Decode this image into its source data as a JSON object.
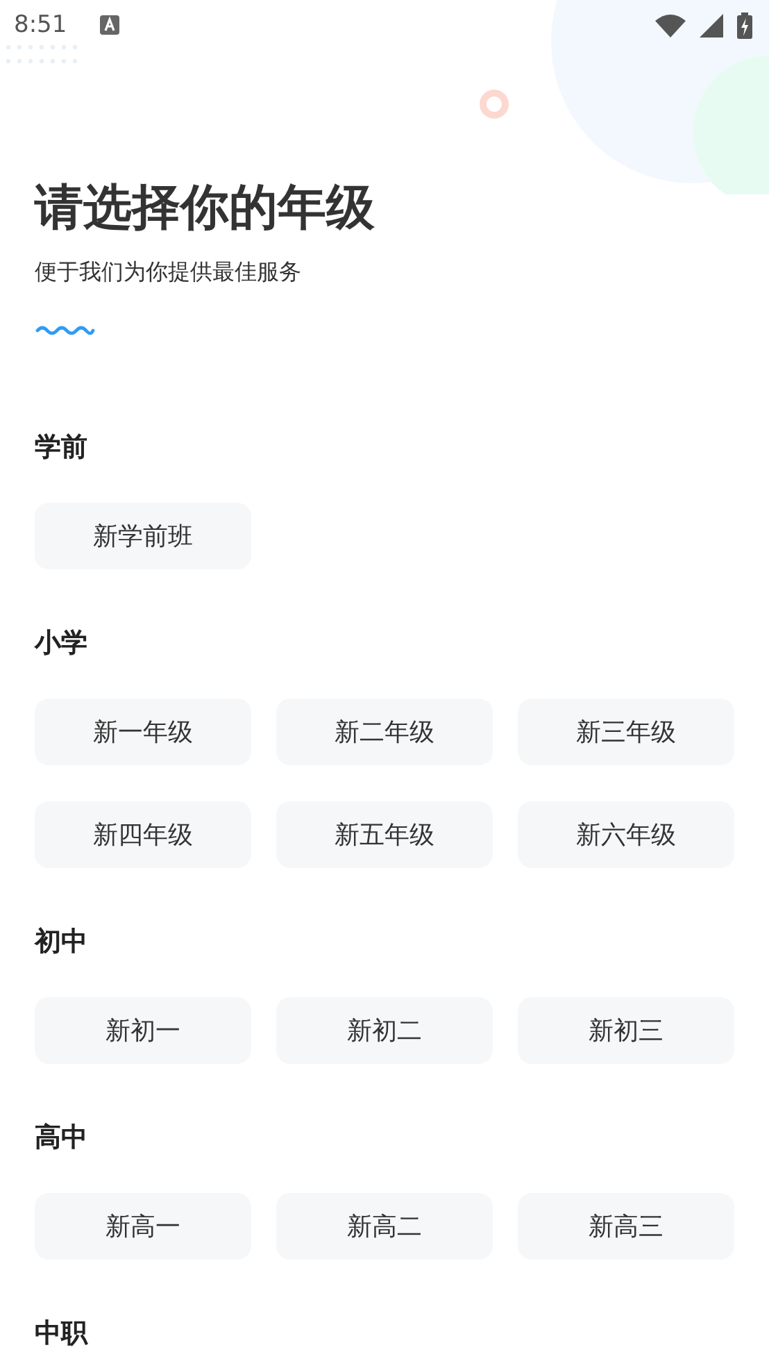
{
  "status_bar": {
    "time": "8:51"
  },
  "title": "请选择你的年级",
  "subtitle": "便于我们为你提供最佳服务",
  "sections": [
    {
      "heading": "学前",
      "grades": [
        {
          "label": "新学前班",
          "selected": false
        }
      ]
    },
    {
      "heading": "小学",
      "grades": [
        {
          "label": "新一年级",
          "selected": false
        },
        {
          "label": "新二年级",
          "selected": false
        },
        {
          "label": "新三年级",
          "selected": false
        },
        {
          "label": "新四年级",
          "selected": false
        },
        {
          "label": "新五年级",
          "selected": false
        },
        {
          "label": "新六年级",
          "selected": false
        }
      ]
    },
    {
      "heading": "初中",
      "grades": [
        {
          "label": "新初一",
          "selected": false
        },
        {
          "label": "新初二",
          "selected": false
        },
        {
          "label": "新初三",
          "selected": false
        }
      ]
    },
    {
      "heading": "高中",
      "grades": [
        {
          "label": "新高一",
          "selected": false
        },
        {
          "label": "新高二",
          "selected": false
        },
        {
          "label": "新高三",
          "selected": false
        }
      ]
    },
    {
      "heading": "中职"
    }
  ]
}
